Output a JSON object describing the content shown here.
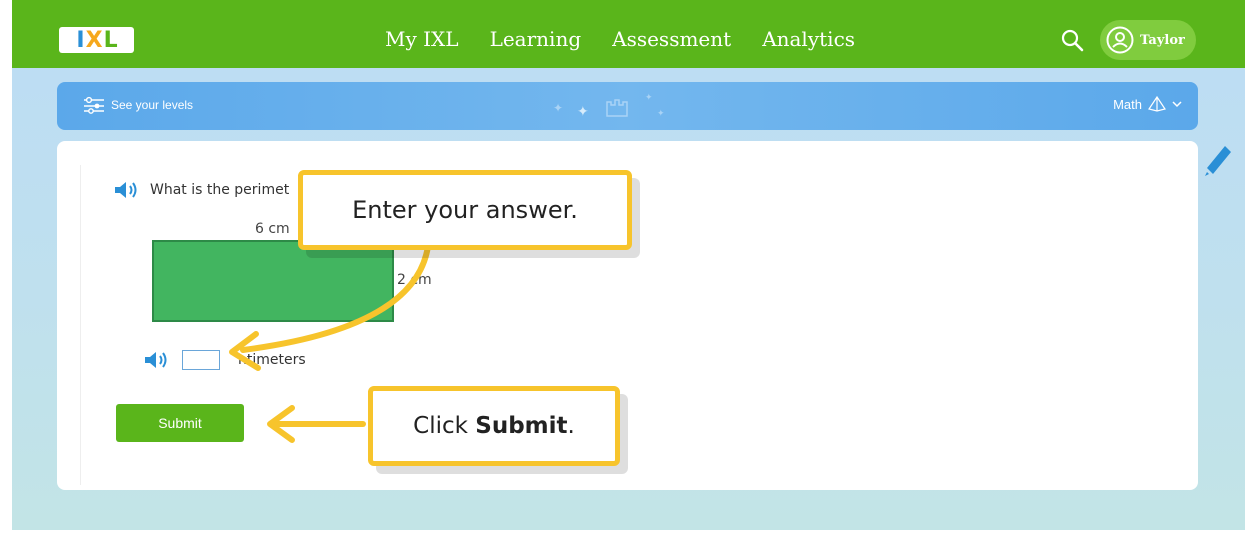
{
  "nav": {
    "logo_text": [
      "I",
      "X",
      "L"
    ],
    "links": [
      "My IXL",
      "Learning",
      "Assessment",
      "Analytics"
    ],
    "user_name": "Taylor",
    "brand_color": "#5ab51b"
  },
  "levels_bar": {
    "label": "See your levels",
    "subject": "Math"
  },
  "question": {
    "prompt": "What is the perimet",
    "top_side": "6 cm",
    "right_side": "2 cm",
    "answer_value": "",
    "unit": "ntimeters",
    "submit_label": "Submit"
  },
  "callouts": {
    "enter_answer": "Enter your answer.",
    "click_prefix": "Click ",
    "click_bold": "Submit",
    "click_suffix": "."
  },
  "icons": {
    "search": "search-icon",
    "avatar": "user-avatar-icon",
    "levels": "sliders-icon",
    "subject": "pyramid-icon",
    "audio": "speaker-icon",
    "edit": "pencil-icon"
  }
}
